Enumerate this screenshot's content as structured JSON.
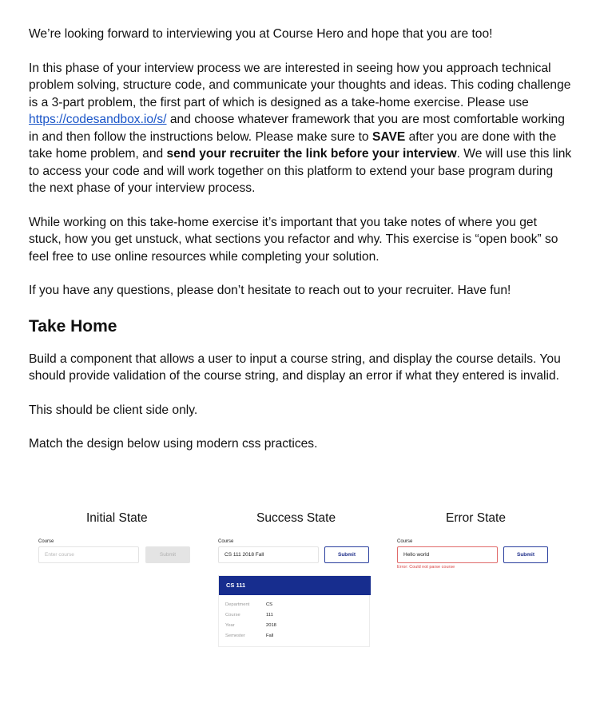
{
  "intro": {
    "p1": "We’re looking forward to interviewing you at Course Hero and hope that you are too!",
    "p2_a": "In this phase of your interview process we are interested in seeing how you approach technical problem solving, structure code, and communicate your thoughts and ideas. This coding challenge is a 3-part problem, the first part of which is designed as a take-home exercise. Please use ",
    "p2_link": "https://codesandbox.io/s/",
    "p2_b": " and choose whatever framework that you are most comfortable working in and then follow the instructions below. Please make sure to ",
    "p2_save": "SAVE",
    "p2_c": " after you are done with the take home problem, and ",
    "p2_send": "send your recruiter the link before your interview",
    "p2_d": ". We will use this link to access your code and will work together on this platform to extend your base program during the next phase of your interview process.",
    "p3": "While working on this take-home exercise it’s important that you take notes of where you get stuck, how you get unstuck, what sections you refactor and why. This exercise is “open book” so feel free to use online resources while completing your solution.",
    "p4": "If you have any questions, please don’t hesitate to reach out to your recruiter. Have fun!"
  },
  "take_home": {
    "heading": "Take Home",
    "p1": "Build a component that allows a user to input a course string, and display the course details. You should provide validation of the course string, and display an error if what they entered is invalid.",
    "p2": "This should be client side only.",
    "p3": "Match the design below using modern css practices."
  },
  "mockups": {
    "initial": {
      "title": "Initial State",
      "label": "Course",
      "placeholder": "Enter course",
      "button": "Submit"
    },
    "success": {
      "title": "Success State",
      "label": "Course",
      "value": "CS 111 2018 Fall",
      "button": "Submit",
      "card_title": "CS 111",
      "details": [
        {
          "key": "Department",
          "value": "CS"
        },
        {
          "key": "Course",
          "value": "111"
        },
        {
          "key": "Year",
          "value": "2018"
        },
        {
          "key": "Semester",
          "value": "Fall"
        }
      ]
    },
    "error": {
      "title": "Error State",
      "label": "Course",
      "value": "Hello world",
      "button": "Submit",
      "error_text": "Error: Could not parse course"
    }
  },
  "colors": {
    "link": "#1a55c8",
    "primary": "#172d8e",
    "error": "#d94242"
  }
}
